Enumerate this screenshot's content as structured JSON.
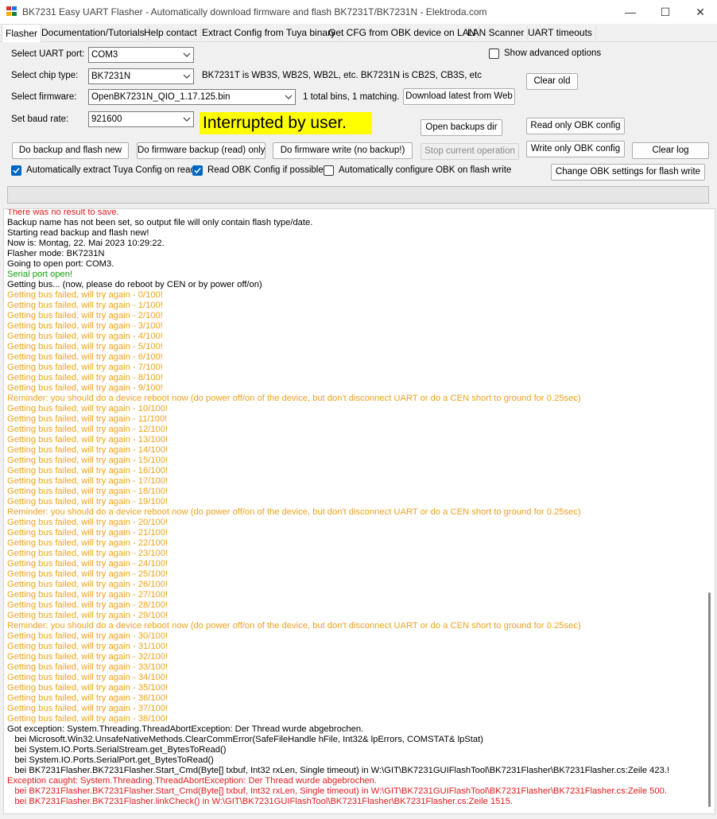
{
  "window": {
    "title": "BK7231 Easy UART Flasher - Automatically download firmware and flash BK7231T/BK7231N  - Elektroda.com",
    "minimize": "—",
    "maximize": "☐",
    "close": "✕"
  },
  "tabs": [
    "Flasher",
    "Documentation/Tutorials",
    "Help contact",
    "Extract Config from Tuya binary",
    "Get CFG from OBK device on LAN",
    "LAN Scanner",
    "UART timeouts"
  ],
  "form": {
    "uart_label": "Select UART port:",
    "uart_value": "COM3",
    "chip_label": "Select chip type:",
    "chip_value": "BK7231N",
    "chip_info": "BK7231T is WB3S, WB2S, WB2L, etc. BK7231N is CB2S, CB3S, etc",
    "firmware_label": "Select firmware:",
    "firmware_value": "OpenBK7231N_QIO_1.17.125.bin",
    "firmware_info": "1 total bins, 1 matching.",
    "baud_label": "Set baud rate:",
    "baud_value": "921600",
    "status_text": "Interrupted by user.",
    "show_advanced": "Show advanced options"
  },
  "buttons": {
    "clear_old": "Clear old",
    "download_latest": "Download latest from Web",
    "open_backups": "Open backups dir",
    "read_only_obk": "Read only OBK config",
    "backup_and_flash": "Do backup and flash new",
    "firmware_backup": "Do firmware backup (read) only",
    "firmware_write": "Do firmware write (no backup!)",
    "stop": "Stop current operation",
    "write_only_obk": "Write only OBK config",
    "clear_log": "Clear log",
    "change_obk": "Change OBK settings for flash write"
  },
  "checks": {
    "extract_tuya": "Automatically extract Tuya Config on read",
    "read_obk": "Read OBK Config if possible",
    "auto_configure": "Automatically configure OBK on flash write"
  },
  "colors": {
    "red": "#e31a1a",
    "orange": "#f0a21c",
    "green": "#12a012",
    "status_bg": "#ffff00",
    "accent": "#0067c0"
  },
  "log": [
    {
      "t": "There was no result to save.",
      "c": "red"
    },
    {
      "t": "Backup name has not been set, so output file will only contain flash type/date.",
      "c": "black"
    },
    {
      "t": "Starting read backup and flash new!",
      "c": "black"
    },
    {
      "t": "Now is: Montag, 22. Mai 2023 10:29:22.",
      "c": "black"
    },
    {
      "t": "Flasher mode: BK7231N",
      "c": "black"
    },
    {
      "t": "Going to open port: COM3.",
      "c": "black"
    },
    {
      "t": "Serial port open!",
      "c": "green"
    },
    {
      "t": "Getting bus... (now, please do reboot by CEN or by power off/on)",
      "c": "black"
    },
    {
      "t": "Getting bus failed, will try again - 0/100!",
      "c": "orange"
    },
    {
      "t": "Getting bus failed, will try again - 1/100!",
      "c": "orange"
    },
    {
      "t": "Getting bus failed, will try again - 2/100!",
      "c": "orange"
    },
    {
      "t": "Getting bus failed, will try again - 3/100!",
      "c": "orange"
    },
    {
      "t": "Getting bus failed, will try again - 4/100!",
      "c": "orange"
    },
    {
      "t": "Getting bus failed, will try again - 5/100!",
      "c": "orange"
    },
    {
      "t": "Getting bus failed, will try again - 6/100!",
      "c": "orange"
    },
    {
      "t": "Getting bus failed, will try again - 7/100!",
      "c": "orange"
    },
    {
      "t": "Getting bus failed, will try again - 8/100!",
      "c": "orange"
    },
    {
      "t": "Getting bus failed, will try again - 9/100!",
      "c": "orange"
    },
    {
      "t": "Reminder: you should do a device reboot now (do power off/on of the device, but don't disconnect UART or do a CEN short to ground for 0.25sec)",
      "c": "orange"
    },
    {
      "t": "Getting bus failed, will try again - 10/100!",
      "c": "orange"
    },
    {
      "t": "Getting bus failed, will try again - 11/100!",
      "c": "orange"
    },
    {
      "t": "Getting bus failed, will try again - 12/100!",
      "c": "orange"
    },
    {
      "t": "Getting bus failed, will try again - 13/100!",
      "c": "orange"
    },
    {
      "t": "Getting bus failed, will try again - 14/100!",
      "c": "orange"
    },
    {
      "t": "Getting bus failed, will try again - 15/100!",
      "c": "orange"
    },
    {
      "t": "Getting bus failed, will try again - 16/100!",
      "c": "orange"
    },
    {
      "t": "Getting bus failed, will try again - 17/100!",
      "c": "orange"
    },
    {
      "t": "Getting bus failed, will try again - 18/100!",
      "c": "orange"
    },
    {
      "t": "Getting bus failed, will try again - 19/100!",
      "c": "orange"
    },
    {
      "t": "Reminder: you should do a device reboot now (do power off/on of the device, but don't disconnect UART or do a CEN short to ground for 0.25sec)",
      "c": "orange"
    },
    {
      "t": "Getting bus failed, will try again - 20/100!",
      "c": "orange"
    },
    {
      "t": "Getting bus failed, will try again - 21/100!",
      "c": "orange"
    },
    {
      "t": "Getting bus failed, will try again - 22/100!",
      "c": "orange"
    },
    {
      "t": "Getting bus failed, will try again - 23/100!",
      "c": "orange"
    },
    {
      "t": "Getting bus failed, will try again - 24/100!",
      "c": "orange"
    },
    {
      "t": "Getting bus failed, will try again - 25/100!",
      "c": "orange"
    },
    {
      "t": "Getting bus failed, will try again - 26/100!",
      "c": "orange"
    },
    {
      "t": "Getting bus failed, will try again - 27/100!",
      "c": "orange"
    },
    {
      "t": "Getting bus failed, will try again - 28/100!",
      "c": "orange"
    },
    {
      "t": "Getting bus failed, will try again - 29/100!",
      "c": "orange"
    },
    {
      "t": "Reminder: you should do a device reboot now (do power off/on of the device, but don't disconnect UART or do a CEN short to ground for 0.25sec)",
      "c": "orange"
    },
    {
      "t": "Getting bus failed, will try again - 30/100!",
      "c": "orange"
    },
    {
      "t": "Getting bus failed, will try again - 31/100!",
      "c": "orange"
    },
    {
      "t": "Getting bus failed, will try again - 32/100!",
      "c": "orange"
    },
    {
      "t": "Getting bus failed, will try again - 33/100!",
      "c": "orange"
    },
    {
      "t": "Getting bus failed, will try again - 34/100!",
      "c": "orange"
    },
    {
      "t": "Getting bus failed, will try again - 35/100!",
      "c": "orange"
    },
    {
      "t": "Getting bus failed, will try again - 36/100!",
      "c": "orange"
    },
    {
      "t": "Getting bus failed, will try again - 37/100!",
      "c": "orange"
    },
    {
      "t": "Getting bus failed, will try again - 38/100!",
      "c": "orange"
    },
    {
      "t": "Got exception: System.Threading.ThreadAbortException: Der Thread wurde abgebrochen.",
      "c": "black"
    },
    {
      "t": "   bei Microsoft.Win32.UnsafeNativeMethods.ClearCommError(SafeFileHandle hFile, Int32& lpErrors, COMSTAT& lpStat)",
      "c": "black"
    },
    {
      "t": "   bei System.IO.Ports.SerialStream.get_BytesToRead()",
      "c": "black"
    },
    {
      "t": "   bei System.IO.Ports.SerialPort.get_BytesToRead()",
      "c": "black"
    },
    {
      "t": "   bei BK7231Flasher.BK7231Flasher.Start_Cmd(Byte[] txbuf, Int32 rxLen, Single timeout) in W:\\GIT\\BK7231GUIFlashTool\\BK7231Flasher\\BK7231Flasher.cs:Zeile 423.!",
      "c": "black"
    },
    {
      "t": "Exception caught: System.Threading.ThreadAbortException: Der Thread wurde abgebrochen.",
      "c": "red"
    },
    {
      "t": "   bei BK7231Flasher.BK7231Flasher.Start_Cmd(Byte[] txbuf, Int32 rxLen, Single timeout) in W:\\GIT\\BK7231GUIFlashTool\\BK7231Flasher\\BK7231Flasher.cs:Zeile 500.",
      "c": "red"
    },
    {
      "t": "   bei BK7231Flasher.BK7231Flasher.linkCheck() in W:\\GIT\\BK7231GUIFlashTool\\BK7231Flasher\\BK7231Flasher.cs:Zeile 1515.",
      "c": "red"
    }
  ]
}
